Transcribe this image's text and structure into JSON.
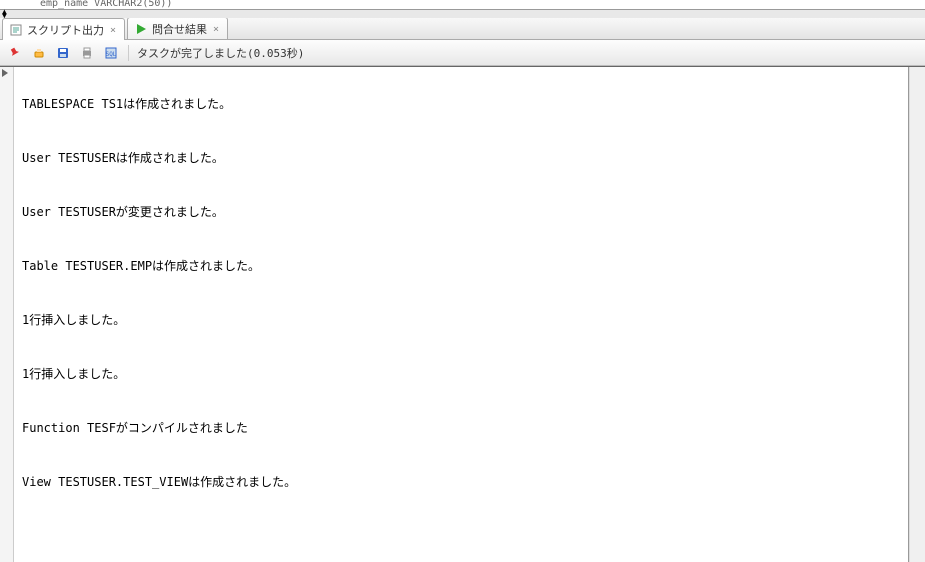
{
  "top_fragment": "emp_name  VARCHAR2(50))",
  "tabs": [
    {
      "label": "スクリプト出力",
      "icon": "script"
    },
    {
      "label": "問合せ結果",
      "icon": "play"
    }
  ],
  "toolbar": {
    "status": "タスクが完了しました(0.053秒)"
  },
  "output_lines": [
    "",
    "TABLESPACE TS1は作成されました。",
    "",
    "",
    "User TESTUSERは作成されました。",
    "",
    "",
    "User TESTUSERが変更されました。",
    "",
    "",
    "Table TESTUSER.EMPは作成されました。",
    "",
    "",
    "1行挿入しました。",
    "",
    "",
    "1行挿入しました。",
    "",
    "",
    "Function TESFがコンパイルされました",
    "",
    "",
    "View TESTUSER.TEST_VIEWは作成されました。",
    ""
  ]
}
